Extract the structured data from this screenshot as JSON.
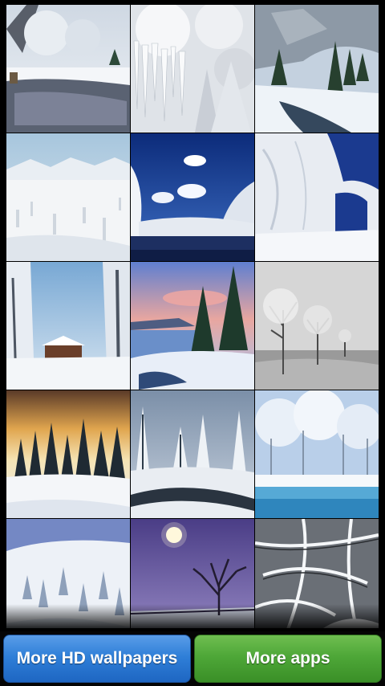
{
  "buttons": {
    "wallpapers_label": "More HD wallpapers",
    "apps_label": "More apps"
  },
  "colors": {
    "blue_button": "#2f7fd8",
    "green_button": "#4ea738",
    "background": "#000000"
  },
  "thumbnails": [
    {
      "name": "snowy-forest-river-thumbnail"
    },
    {
      "name": "icicle-frozen-trees-thumbnail"
    },
    {
      "name": "mountain-valley-stream-thumbnail"
    },
    {
      "name": "snowy-plain-mountains-thumbnail"
    },
    {
      "name": "blue-sky-lake-thumbnail"
    },
    {
      "name": "glacier-arch-thumbnail"
    },
    {
      "name": "frosted-cabin-thumbnail"
    },
    {
      "name": "sunset-lake-pines-thumbnail"
    },
    {
      "name": "foggy-bare-trees-thumbnail"
    },
    {
      "name": "golden-sky-forest-thumbnail"
    },
    {
      "name": "snowy-creek-thumbnail"
    },
    {
      "name": "frozen-pond-thumbnail"
    },
    {
      "name": "snowy-hillside-thumbnail"
    },
    {
      "name": "moonlit-tree-thumbnail"
    },
    {
      "name": "snowy-branches-thumbnail"
    }
  ]
}
